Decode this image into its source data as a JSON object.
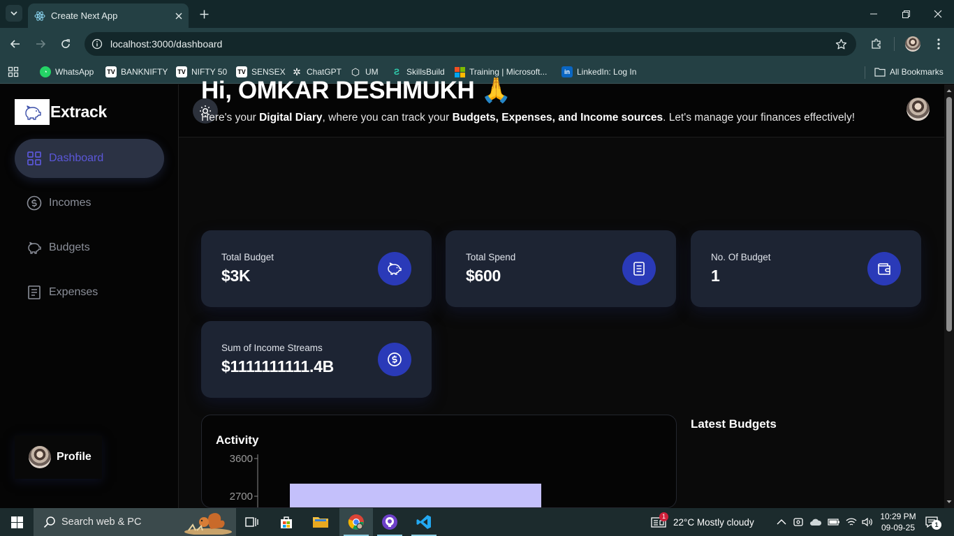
{
  "browser": {
    "tab_title": "Create Next App",
    "url": "localhost:3000/dashboard",
    "bookmarks": [
      "WhatsApp",
      "BANKNIFTY",
      "NIFTY 50",
      "SENSEX",
      "ChatGPT",
      "UM",
      "SkillsBuild",
      "Training | Microsoft...",
      "LinkedIn: Log In"
    ],
    "all_bookmarks": "All Bookmarks"
  },
  "sidebar": {
    "logo_text": "Extrack",
    "items": [
      {
        "label": "Dashboard",
        "icon": "layout-grid-icon",
        "active": true
      },
      {
        "label": "Incomes",
        "icon": "circle-dollar-icon"
      },
      {
        "label": "Budgets",
        "icon": "piggy-bank-icon"
      },
      {
        "label": "Expenses",
        "icon": "receipt-icon"
      }
    ],
    "profile_label": "Profile"
  },
  "main": {
    "greeting": "Hi, OMKAR DESHMUKH 🙏",
    "subtitle": {
      "p1": "Here's your ",
      "b1": "Digital Diary",
      "p2": ", where you can track your ",
      "b2": "Budgets, Expenses, and Income sources",
      "p3": ". Let's manage your finances effectively!"
    },
    "cards": [
      {
        "label": "Total Budget",
        "value": "$3K",
        "icon": "piggy-bank-icon"
      },
      {
        "label": "Total Spend",
        "value": "$600",
        "icon": "receipt-icon"
      },
      {
        "label": "No. Of Budget",
        "value": "1",
        "icon": "wallet-icon"
      },
      {
        "label": "Sum of Income Streams",
        "value": "$1111111111.4B",
        "icon": "circle-dollar-icon"
      }
    ],
    "activity_title": "Activity",
    "latest_budgets_title": "Latest Budgets"
  },
  "chart_data": {
    "type": "bar",
    "title": "Activity",
    "y_ticks": [
      3600,
      2700
    ],
    "series": [
      {
        "values": [
          3000
        ],
        "color": "#c4c0fb"
      }
    ],
    "grid": false
  },
  "colors": {
    "accent": "#2a3ab8",
    "active_nav_text": "#5b57d9",
    "card_bg": "#1d2433",
    "bar": "#c4c0fb"
  },
  "taskbar": {
    "search_placeholder": "Search web & PC",
    "weather": "22°C  Mostly cloudy",
    "notification_badge": "1",
    "time": "10:29 PM",
    "date": "09-09-25",
    "action_center_badge": "1"
  }
}
